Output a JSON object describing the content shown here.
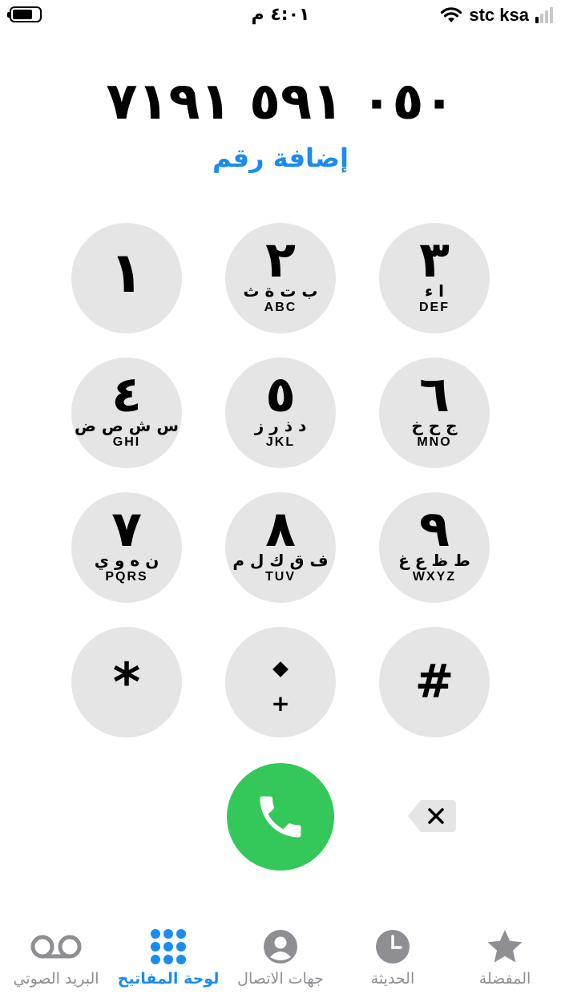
{
  "status_bar": {
    "time": "٤:٠١ م",
    "carrier": "stc ksa"
  },
  "dialer": {
    "number": "٠٥٠ ٥٩١ ٧١٩١",
    "add_number": "إضافة رقم"
  },
  "keypad": {
    "k1": {
      "digit": "١",
      "arabic": "",
      "latin": ""
    },
    "k2": {
      "digit": "٢",
      "arabic": "ب ت ة ث",
      "latin": "ABC"
    },
    "k3": {
      "digit": "٣",
      "arabic": "ا ء",
      "latin": "DEF"
    },
    "k4": {
      "digit": "٤",
      "arabic": "س ش ص ض",
      "latin": "GHI"
    },
    "k5": {
      "digit": "٥",
      "arabic": "د ذ ر ز",
      "latin": "JKL"
    },
    "k6": {
      "digit": "٦",
      "arabic": "ج ح خ",
      "latin": "MNO"
    },
    "k7": {
      "digit": "٧",
      "arabic": "ن ه و ي",
      "latin": "PQRS"
    },
    "k8": {
      "digit": "٨",
      "arabic": "ف ق ك ل م",
      "latin": "TUV"
    },
    "k9": {
      "digit": "٩",
      "arabic": "ط ظ ع غ",
      "latin": "WXYZ"
    },
    "star": {
      "symbol": "*"
    },
    "zero": {
      "plus": "+"
    },
    "hash": {
      "symbol": "#"
    }
  },
  "tabs": {
    "favorites": {
      "label": "المفضلة",
      "icon": "star-icon"
    },
    "recents": {
      "label": "الحديثة",
      "icon": "clock-icon"
    },
    "contacts": {
      "label": "جهات الاتصال",
      "icon": "person-icon"
    },
    "keypad": {
      "label": "لوحة المفاتيح",
      "icon": "keypad-icon"
    },
    "voicemail": {
      "label": "البريد الصوتي",
      "icon": "voicemail-icon"
    }
  },
  "colors": {
    "accent": "#1a8cf0",
    "call_green": "#34c759",
    "key_bg": "#e5e5e5",
    "tab_inactive": "#8e8e93"
  }
}
